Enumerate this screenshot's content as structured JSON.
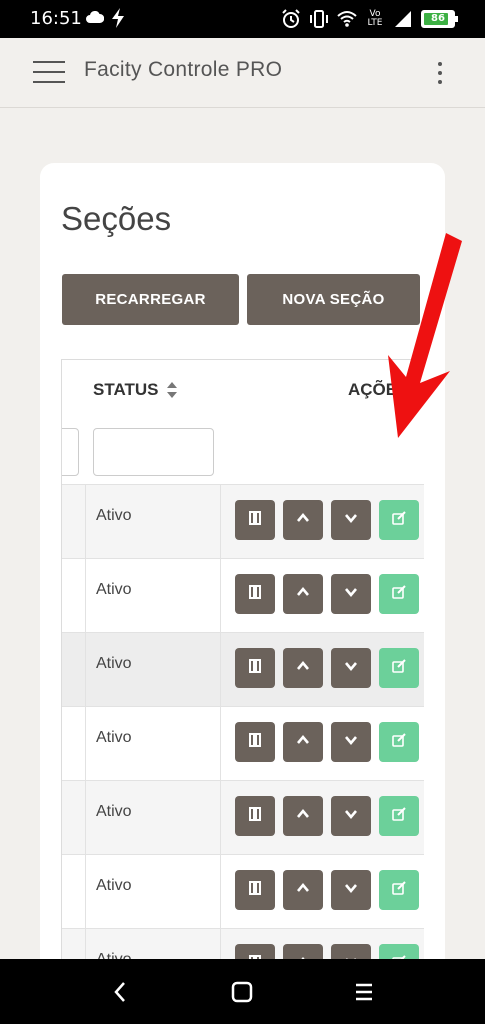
{
  "status_bar": {
    "time": "16:51",
    "network": "Vo LTE",
    "signal": "4G",
    "battery": "86",
    "battery_level": 0.86
  },
  "app_bar": {
    "title": "Facity Controle PRO",
    "menu_icon": "hamburger-menu-icon",
    "more_icon": "more-vert-icon"
  },
  "page": {
    "title": "Seções",
    "reload_label": "RECARREGAR",
    "new_label": "NOVA SEÇÃO"
  },
  "table": {
    "columns": {
      "status": "STATUS",
      "actions": "AÇÕES"
    },
    "filter_status_value": "",
    "rows": [
      {
        "status": "Ativo"
      },
      {
        "status": "Ativo"
      },
      {
        "status": "Ativo"
      },
      {
        "status": "Ativo"
      },
      {
        "status": "Ativo"
      },
      {
        "status": "Ativo"
      },
      {
        "status": "Ativo"
      }
    ]
  },
  "colors": {
    "action_button": "#6b625b",
    "edit_button": "#6cd09a",
    "annotation_arrow": "#ee1111"
  }
}
